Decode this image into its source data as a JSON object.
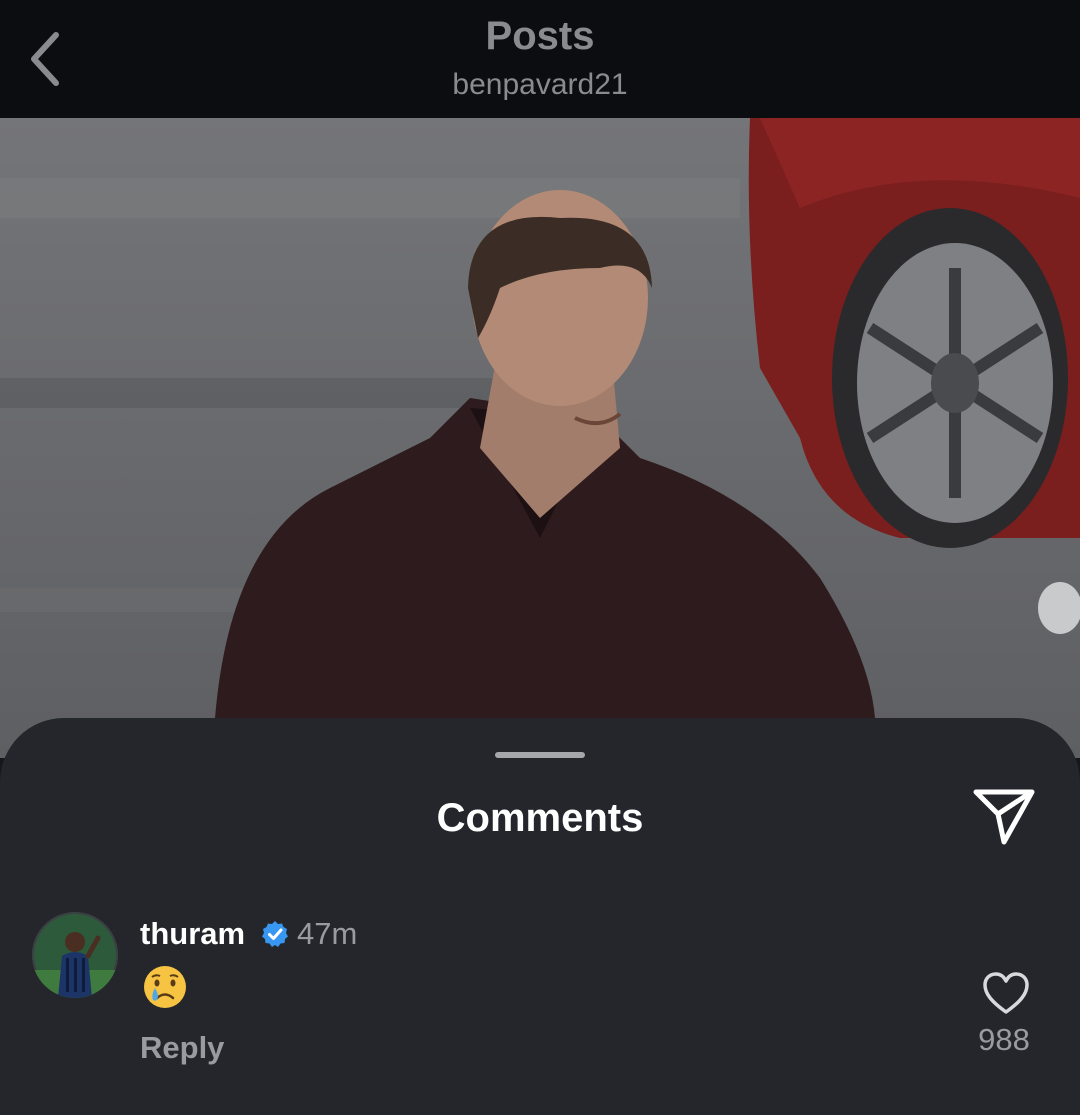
{
  "header": {
    "title": "Posts",
    "subtitle": "benpavard21",
    "back_icon": "chevron-left-icon"
  },
  "post": {
    "image_description_icon": "post-photo"
  },
  "comments_sheet": {
    "title": "Comments",
    "share_icon": "paper-plane-icon",
    "comments": [
      {
        "username": "thuram",
        "verified": true,
        "time": "47m",
        "text_emoji": "crying-face",
        "reply_label": "Reply",
        "like_count": "988"
      }
    ]
  },
  "colors": {
    "background": "#24262b",
    "topbar": "#0c0d10",
    "muted_text": "#9a9ba0",
    "verified_blue": "#3897f0"
  }
}
